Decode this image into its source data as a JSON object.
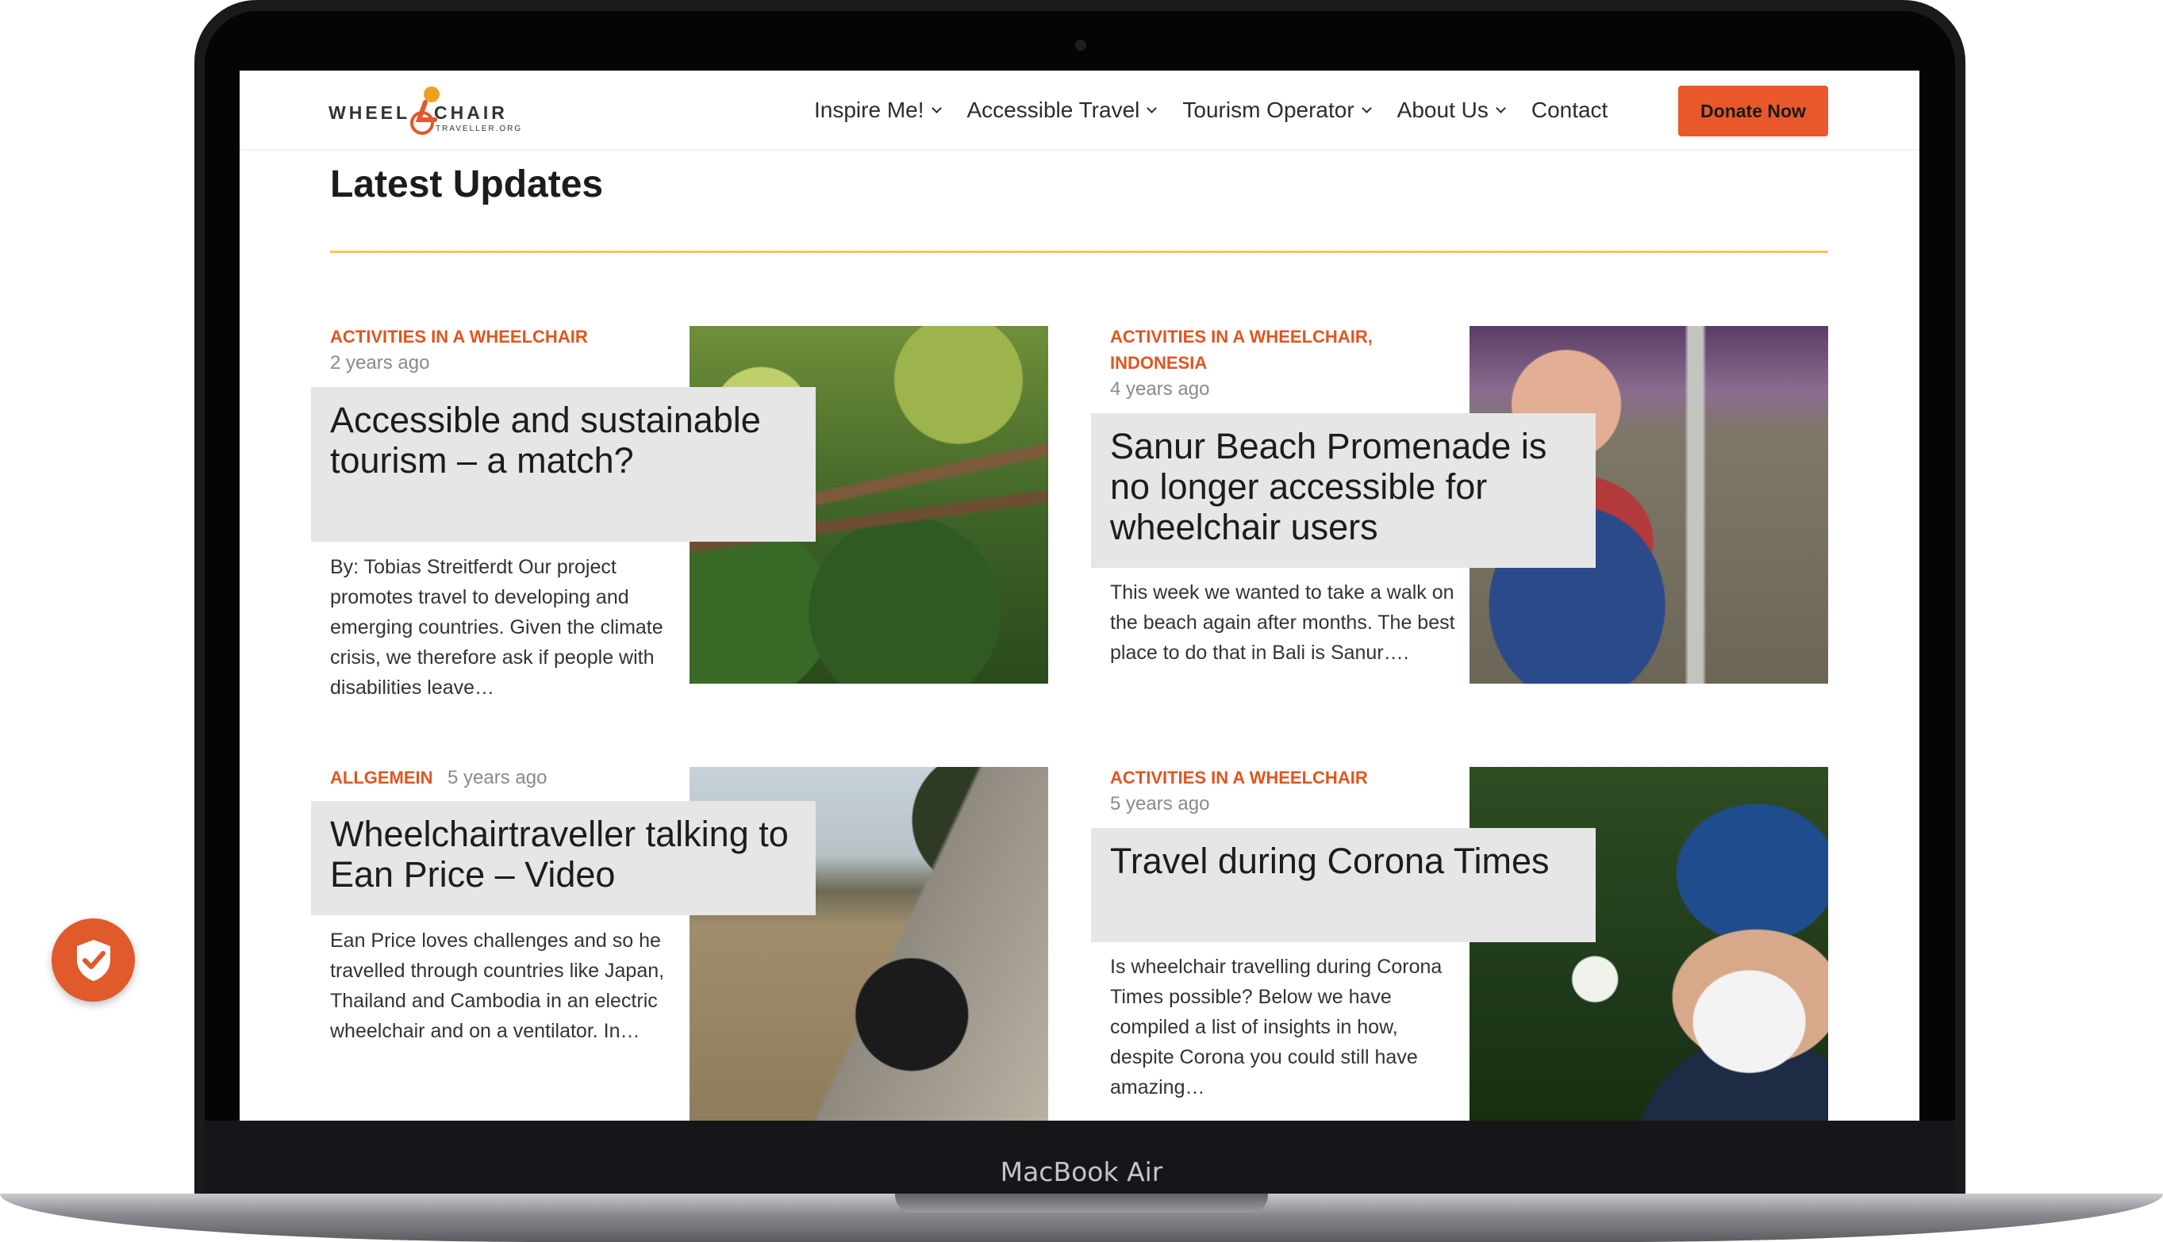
{
  "device": {
    "label": "MacBook Air"
  },
  "header": {
    "logo": {
      "line1": "WHEEL",
      "line2": "CHAIR",
      "sub": "TRAVELLER.ORG"
    },
    "nav": [
      {
        "label": "Inspire Me!",
        "has_dropdown": true
      },
      {
        "label": "Accessible Travel",
        "has_dropdown": true
      },
      {
        "label": "Tourism Operator",
        "has_dropdown": true
      },
      {
        "label": "About Us",
        "has_dropdown": true
      },
      {
        "label": "Contact",
        "has_dropdown": false
      }
    ],
    "donate_label": "Donate Now"
  },
  "main": {
    "section_title": "Latest Updates",
    "posts": [
      {
        "category": "ACTIVITIES IN A WHEELCHAIR",
        "date": "2 years ago",
        "title": "Accessible and sustainable tourism – a match?",
        "excerpt": "By: Tobias Streitferdt Our project promotes travel to developing and emerging countries. Given the climate crisis, we therefore ask if people with disabilities leave…"
      },
      {
        "category": "ACTIVITIES IN A WHEELCHAIR,",
        "category2": "INDONESIA",
        "date": "4 years ago",
        "title": "Sanur Beach Promenade is no longer accessible for wheelchair users",
        "excerpt": "This week we wanted to take a walk on the beach again after months. The best place to do that in Bali is Sanur…."
      },
      {
        "category": "ALLGEMEIN",
        "date": "5 years ago",
        "title": "Wheelchairtraveller talking to Ean Price – Video",
        "excerpt": "Ean Price loves challenges and so he travelled through countries like Japan, Thailand and Cambodia in an electric wheelchair and on a ventilator. In…"
      },
      {
        "category": "ACTIVITIES IN A WHEELCHAIR",
        "date": "5 years ago",
        "title": "Travel during Corona Times",
        "excerpt": "Is wheelchair travelling during Corona Times possible? Below we have compiled a list of insights in how, despite Corona you could still have amazing…"
      }
    ]
  },
  "colors": {
    "accent": "#e0551f",
    "divider": "#f3c94d",
    "title_box": "#e6e6e6"
  },
  "icons": {
    "privacy": "shield-check-icon"
  }
}
